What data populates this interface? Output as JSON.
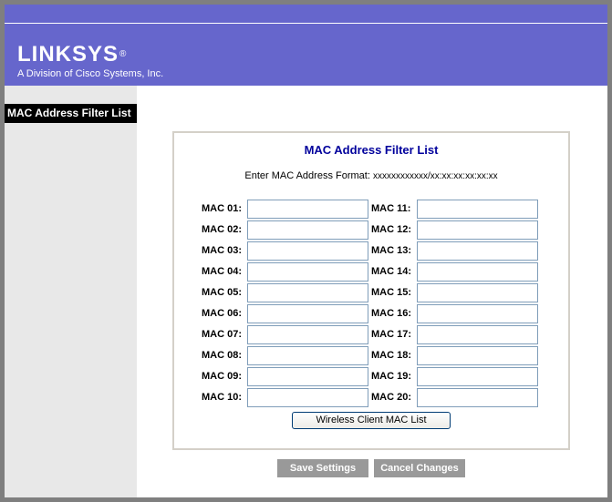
{
  "brand": {
    "logo_text": "LINKSYS",
    "registered_mark": "®",
    "tagline": "A Division of Cisco Systems, Inc."
  },
  "sidebar": {
    "title": "MAC Address Filter List"
  },
  "panel": {
    "title": "MAC Address Filter List",
    "format_label": "Enter MAC Address Format: ",
    "format_value": "xxxxxxxxxxxx/xx:xx:xx:xx:xx:xx"
  },
  "mac_fields": {
    "left": [
      {
        "label": "MAC 01:",
        "value": ""
      },
      {
        "label": "MAC 02:",
        "value": ""
      },
      {
        "label": "MAC 03:",
        "value": ""
      },
      {
        "label": "MAC 04:",
        "value": ""
      },
      {
        "label": "MAC 05:",
        "value": ""
      },
      {
        "label": "MAC 06:",
        "value": ""
      },
      {
        "label": "MAC 07:",
        "value": ""
      },
      {
        "label": "MAC 08:",
        "value": ""
      },
      {
        "label": "MAC 09:",
        "value": ""
      },
      {
        "label": "MAC 10:",
        "value": ""
      }
    ],
    "right": [
      {
        "label": "MAC 11:",
        "value": ""
      },
      {
        "label": "MAC 12:",
        "value": ""
      },
      {
        "label": "MAC 13:",
        "value": ""
      },
      {
        "label": "MAC 14:",
        "value": ""
      },
      {
        "label": "MAC 15:",
        "value": ""
      },
      {
        "label": "MAC 16:",
        "value": ""
      },
      {
        "label": "MAC 17:",
        "value": ""
      },
      {
        "label": "MAC 18:",
        "value": ""
      },
      {
        "label": "MAC 19:",
        "value": ""
      },
      {
        "label": "MAC 20:",
        "value": ""
      }
    ]
  },
  "buttons": {
    "wireless_client": "Wireless Client MAC List",
    "save": "Save Settings",
    "cancel": "Cancel Changes"
  },
  "colors": {
    "header_bg": "#6666cc",
    "panel_title": "#00009c",
    "sidebar_bg": "#e8e8e8",
    "action_button_bg": "#999999"
  }
}
